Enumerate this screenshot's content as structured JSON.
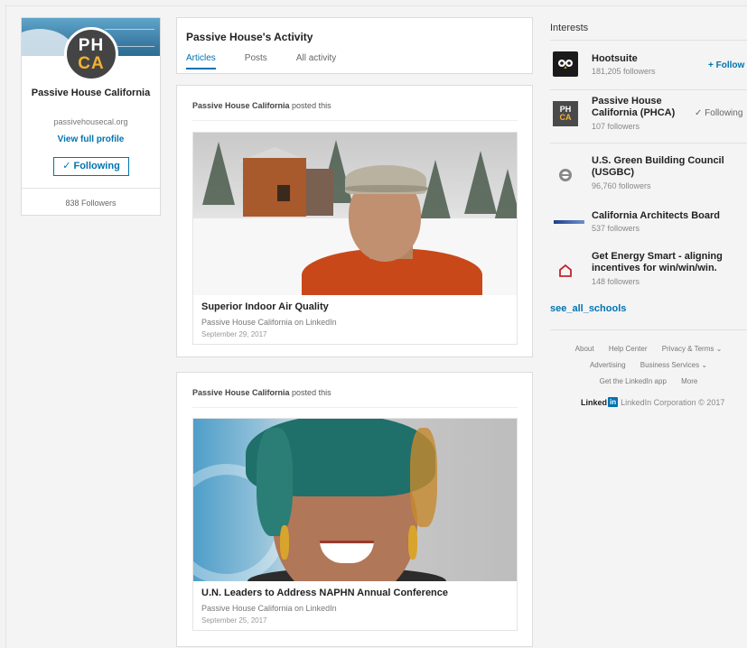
{
  "profile": {
    "logo_line1": "PH",
    "logo_line2": "CA",
    "name": "Passive House California",
    "url": "passivehousecal.org",
    "view_profile": "View full profile",
    "follow_button": "✓ Following",
    "followers": "838 Followers"
  },
  "activity": {
    "title": "Passive House's Activity",
    "tabs": [
      {
        "label": "Articles",
        "active": true
      },
      {
        "label": "Posts",
        "active": false
      },
      {
        "label": "All activity",
        "active": false
      }
    ]
  },
  "posts": [
    {
      "author": "Passive House California",
      "action": " posted this",
      "title": "Superior Indoor Air Quality",
      "source": "Passive House California on LinkedIn",
      "date": "September 29, 2017"
    },
    {
      "author": "Passive House California",
      "action": " posted this",
      "title": "U.N. Leaders to Address NAPHN Annual Conference",
      "source": "Passive House California on LinkedIn",
      "date": "September 25, 2017"
    }
  ],
  "interests": {
    "title": "Interests",
    "items": [
      {
        "name": "Hootsuite",
        "followers": "181,205 followers",
        "action": "+ Follow",
        "icon": "owl-icon"
      },
      {
        "name": "Passive House California (PHCA)",
        "followers": "107 followers",
        "action": "✓ Following",
        "icon": "phca-logo-icon"
      },
      {
        "name": "U.S. Green Building Council (USGBC)",
        "followers": "96,760 followers",
        "action": "",
        "icon": "usgbc-logo-icon"
      },
      {
        "name": "California Architects Board",
        "followers": "537 followers",
        "action": "",
        "icon": "cab-logo-icon"
      },
      {
        "name": "Get Energy Smart - aligning incentives for win/win/win.",
        "followers": "148 followers",
        "action": "",
        "icon": "house-logo-icon"
      }
    ],
    "see_all": "see_all_schools"
  },
  "footer": {
    "row1": [
      "About",
      "Help Center",
      "Privacy & Terms ⌄"
    ],
    "row2": [
      "Advertising",
      "Business Services ⌄"
    ],
    "row3": [
      "Get the LinkedIn app",
      "More"
    ],
    "brand_word": "Linked",
    "brand_in": "in",
    "copyright": "LinkedIn Corporation © 2017"
  },
  "colors": {
    "link_blue": "#0073b1",
    "jacket_orange": "#c9481a",
    "phca_gold": "#f2b234"
  }
}
